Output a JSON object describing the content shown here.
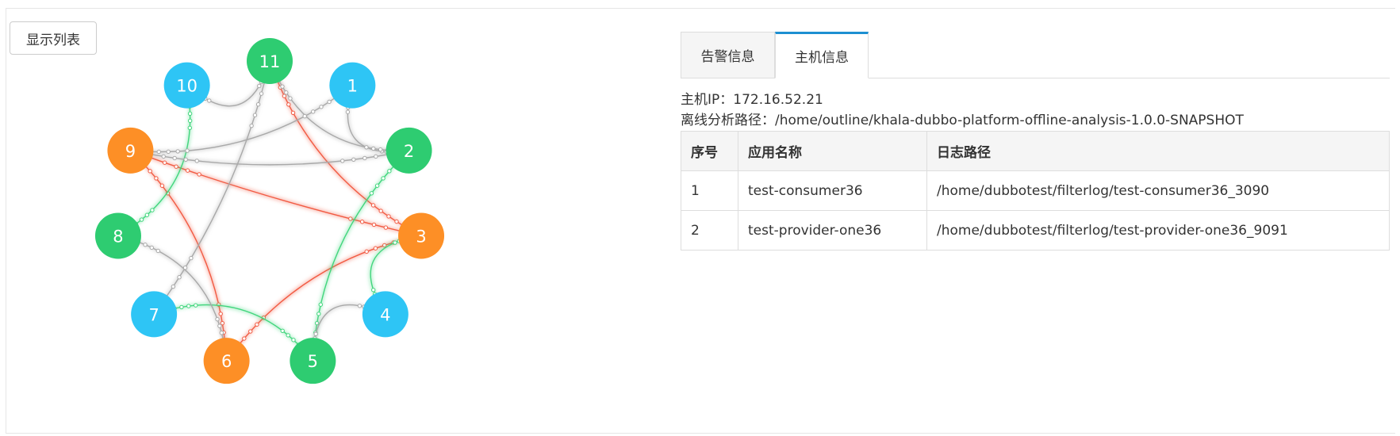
{
  "toolbar": {
    "show_list_label": "显示列表"
  },
  "graph": {
    "colors": {
      "green": "#2ecc71",
      "blue": "#2ec5f5",
      "orange": "#fd8f26",
      "edge_red": "#f25b43",
      "edge_green": "#41d67d",
      "edge_gray": "#a9a9a9"
    },
    "nodes": [
      {
        "id": "1",
        "label": "1",
        "color": "blue"
      },
      {
        "id": "2",
        "label": "2",
        "color": "green"
      },
      {
        "id": "3",
        "label": "3",
        "color": "orange"
      },
      {
        "id": "4",
        "label": "4",
        "color": "blue"
      },
      {
        "id": "5",
        "label": "5",
        "color": "green"
      },
      {
        "id": "6",
        "label": "6",
        "color": "orange"
      },
      {
        "id": "7",
        "label": "7",
        "color": "blue"
      },
      {
        "id": "8",
        "label": "8",
        "color": "green"
      },
      {
        "id": "9",
        "label": "9",
        "color": "orange"
      },
      {
        "id": "10",
        "label": "10",
        "color": "blue"
      },
      {
        "id": "11",
        "label": "11",
        "color": "green"
      }
    ],
    "edges": [
      {
        "from": "11",
        "to": "3",
        "color": "red"
      },
      {
        "from": "9",
        "to": "3",
        "color": "red"
      },
      {
        "from": "9",
        "to": "6",
        "color": "red"
      },
      {
        "from": "3",
        "to": "6",
        "color": "red"
      },
      {
        "from": "2",
        "to": "5",
        "color": "green"
      },
      {
        "from": "10",
        "to": "8",
        "color": "green"
      },
      {
        "from": "7",
        "to": "5",
        "color": "green"
      },
      {
        "from": "3",
        "to": "4",
        "color": "green"
      },
      {
        "from": "1",
        "to": "2",
        "color": "gray"
      },
      {
        "from": "11",
        "to": "2",
        "color": "gray"
      },
      {
        "from": "9",
        "to": "2",
        "color": "gray"
      },
      {
        "from": "10",
        "to": "11",
        "color": "gray"
      },
      {
        "from": "8",
        "to": "6",
        "color": "gray"
      },
      {
        "from": "7",
        "to": "11",
        "color": "gray"
      },
      {
        "from": "5",
        "to": "4",
        "color": "gray"
      },
      {
        "from": "9",
        "to": "1",
        "color": "gray"
      }
    ]
  },
  "tabs": [
    {
      "label": "告警信息",
      "active": false
    },
    {
      "label": "主机信息",
      "active": true
    }
  ],
  "host_info": {
    "ip_line": "主机IP：172.16.52.21",
    "path_line": "离线分析路径：/home/outline/khala-dubbo-platform-offline-analysis-1.0.0-SNAPSHOT"
  },
  "table": {
    "headers": [
      "序号",
      "应用名称",
      "日志路径"
    ],
    "rows": [
      [
        "1",
        "test-consumer36",
        "/home/dubbotest/filterlog/test-consumer36_3090"
      ],
      [
        "2",
        "test-provider-one36",
        "/home/dubbotest/filterlog/test-provider-one36_9091"
      ]
    ]
  }
}
